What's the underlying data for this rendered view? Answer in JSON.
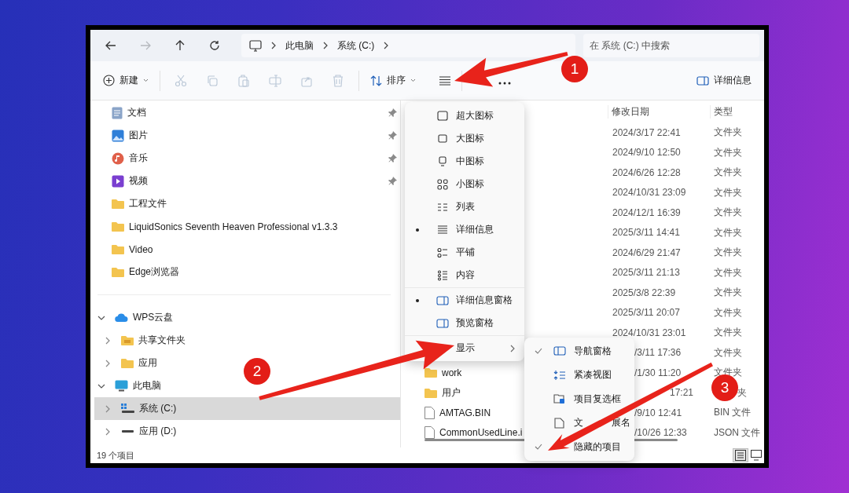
{
  "nav_buttons": [
    {
      "disabled": false
    },
    {
      "disabled": true
    },
    {
      "disabled": false
    },
    {
      "disabled": false
    }
  ],
  "breadcrumb": [
    "此电脑",
    "系统 (C:)"
  ],
  "search": {
    "placeholder": "在 系统 (C:) 中搜索"
  },
  "toolbar": {
    "new_label": "新建",
    "edit_actions": [
      {
        "disabled": true
      },
      {
        "disabled": true
      },
      {
        "disabled": true
      },
      {
        "disabled": true
      },
      {
        "disabled": true
      },
      {
        "disabled": true
      }
    ],
    "sort_label": "排序",
    "details_label": "详细信息"
  },
  "quick_access": [
    {
      "label": "文档",
      "kind": "documents",
      "pinned": true
    },
    {
      "label": "图片",
      "kind": "pictures",
      "pinned": true
    },
    {
      "label": "音乐",
      "kind": "music",
      "pinned": true
    },
    {
      "label": "视频",
      "kind": "videos",
      "pinned": true
    },
    {
      "label": "工程文件",
      "kind": "folder",
      "pinned": false
    },
    {
      "label": "LiquidSonics Seventh Heaven Professional v1.3.3",
      "kind": "folder",
      "pinned": false
    },
    {
      "label": "Video",
      "kind": "folder",
      "pinned": false
    },
    {
      "label": "Edge浏览器",
      "kind": "folder",
      "pinned": false
    }
  ],
  "tree": [
    {
      "label": "WPS云盘",
      "kind": "cloud",
      "expanded": true,
      "selected": false,
      "children": [
        {
          "label": "共享文件夹",
          "kind": "shared",
          "expanded": false,
          "selected": false
        },
        {
          "label": "应用",
          "kind": "folder",
          "expanded": false,
          "selected": false
        }
      ]
    },
    {
      "label": "此电脑",
      "kind": "pc",
      "expanded": true,
      "selected": false,
      "children": [
        {
          "label": "系统 (C:)",
          "kind": "system-drive",
          "expanded": false,
          "selected": true
        },
        {
          "label": "应用 (D:)",
          "kind": "drive",
          "expanded": false,
          "selected": false
        }
      ]
    }
  ],
  "table": {
    "columns": [
      "修改日期",
      "类型"
    ],
    "rows": [
      {
        "date": "2024/3/17 22:41",
        "type": "文件夹"
      },
      {
        "date": "2024/9/10 12:50",
        "type": "文件夹"
      },
      {
        "date": "2024/6/26 12:28",
        "type": "文件夹"
      },
      {
        "date": "2024/10/31 23:09",
        "type": "文件夹"
      },
      {
        "date": "2024/12/1 16:39",
        "type": "文件夹"
      },
      {
        "date": "2025/3/11 14:41",
        "type": "文件夹"
      },
      {
        "date": "2024/6/29 21:47",
        "type": "文件夹"
      },
      {
        "date": "2025/3/11 21:13",
        "type": "文件夹"
      },
      {
        "date": "2025/3/8 22:39",
        "type": "文件夹"
      },
      {
        "date": "2025/3/11 20:07",
        "type": "文件夹"
      },
      {
        "date": "2024/10/31 23:01",
        "type": "文件夹"
      },
      {
        "date": "/3/11 17:36",
        "type": "文件夹"
      },
      {
        "name": "work",
        "kind": "folder",
        "date": "/1/30 11:20",
        "type": "文件夹"
      },
      {
        "name": "用户",
        "kind": "folder",
        "date": "17:21",
        "type": "夹"
      },
      {
        "name": "AMTAG.BIN",
        "kind": "file",
        "date": "/9/10 12:41",
        "type": "BIN 文件"
      },
      {
        "name": "CommonUsedLine.i",
        "kind": "file",
        "date": "/10/26 12:33",
        "type": "JSON 文件"
      }
    ]
  },
  "view_menu": [
    {
      "label": "超大图标",
      "kind": "layout",
      "selected": false
    },
    {
      "label": "大图标",
      "kind": "layout",
      "selected": false
    },
    {
      "label": "中图标",
      "kind": "layout",
      "selected": false
    },
    {
      "label": "小图标",
      "kind": "layout",
      "selected": false
    },
    {
      "label": "列表",
      "kind": "layout",
      "selected": false
    },
    {
      "label": "详细信息",
      "kind": "layout",
      "selected": true
    },
    {
      "label": "平铺",
      "kind": "layout",
      "selected": false
    },
    {
      "label": "内容",
      "kind": "layout",
      "selected": false
    },
    {
      "label": "详细信息窗格",
      "kind": "pane",
      "selected": true
    },
    {
      "label": "预览窗格",
      "kind": "pane",
      "selected": false
    },
    {
      "label": "显示",
      "kind": "submenu",
      "selected": false
    }
  ],
  "show_submenu": [
    {
      "label": "导航窗格",
      "checked": true
    },
    {
      "label": "紧凑视图",
      "checked": false
    },
    {
      "label": "项目复选框",
      "checked": false
    },
    {
      "label": "文",
      "label_2": "展名",
      "checked": false
    },
    {
      "label": "隐藏的项目",
      "checked": true
    }
  ],
  "status_bar": {
    "count": "19 个项目",
    "views": [
      {
        "selected": true
      },
      {
        "selected": false
      }
    ]
  },
  "annotations": [
    {
      "number": "1"
    },
    {
      "number": "2"
    },
    {
      "number": "3"
    }
  ]
}
